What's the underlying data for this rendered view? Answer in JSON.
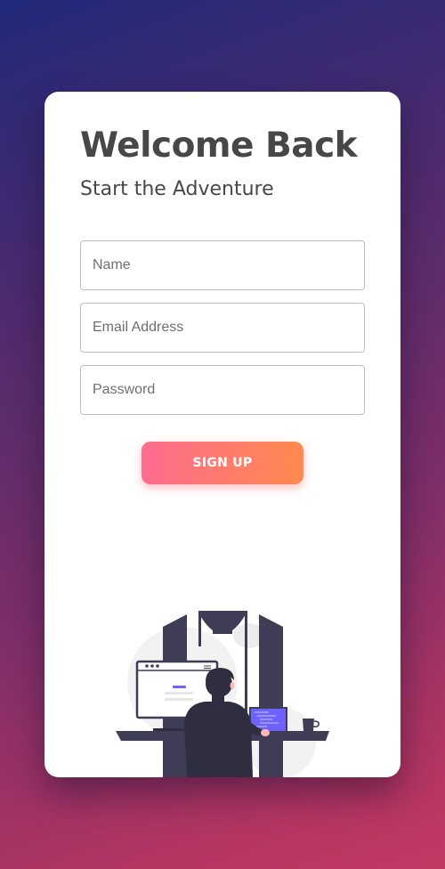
{
  "card": {
    "title": "Welcome Back",
    "subtitle": "Start the Adventure"
  },
  "form": {
    "name_placeholder": "Name",
    "email_placeholder": "Email Address",
    "password_placeholder": "Password",
    "submit_label": "SIGN UP"
  },
  "colors": {
    "background_gradient_start": "#21297a",
    "background_gradient_end": "#c03a63",
    "button_gradient_start": "#ff6b8e",
    "button_gradient_end": "#ff8a4d",
    "illustration_accent": "#6c63ff",
    "illustration_dark": "#3f3d56"
  },
  "illustration": {
    "name": "person-at-computer-illustration"
  }
}
